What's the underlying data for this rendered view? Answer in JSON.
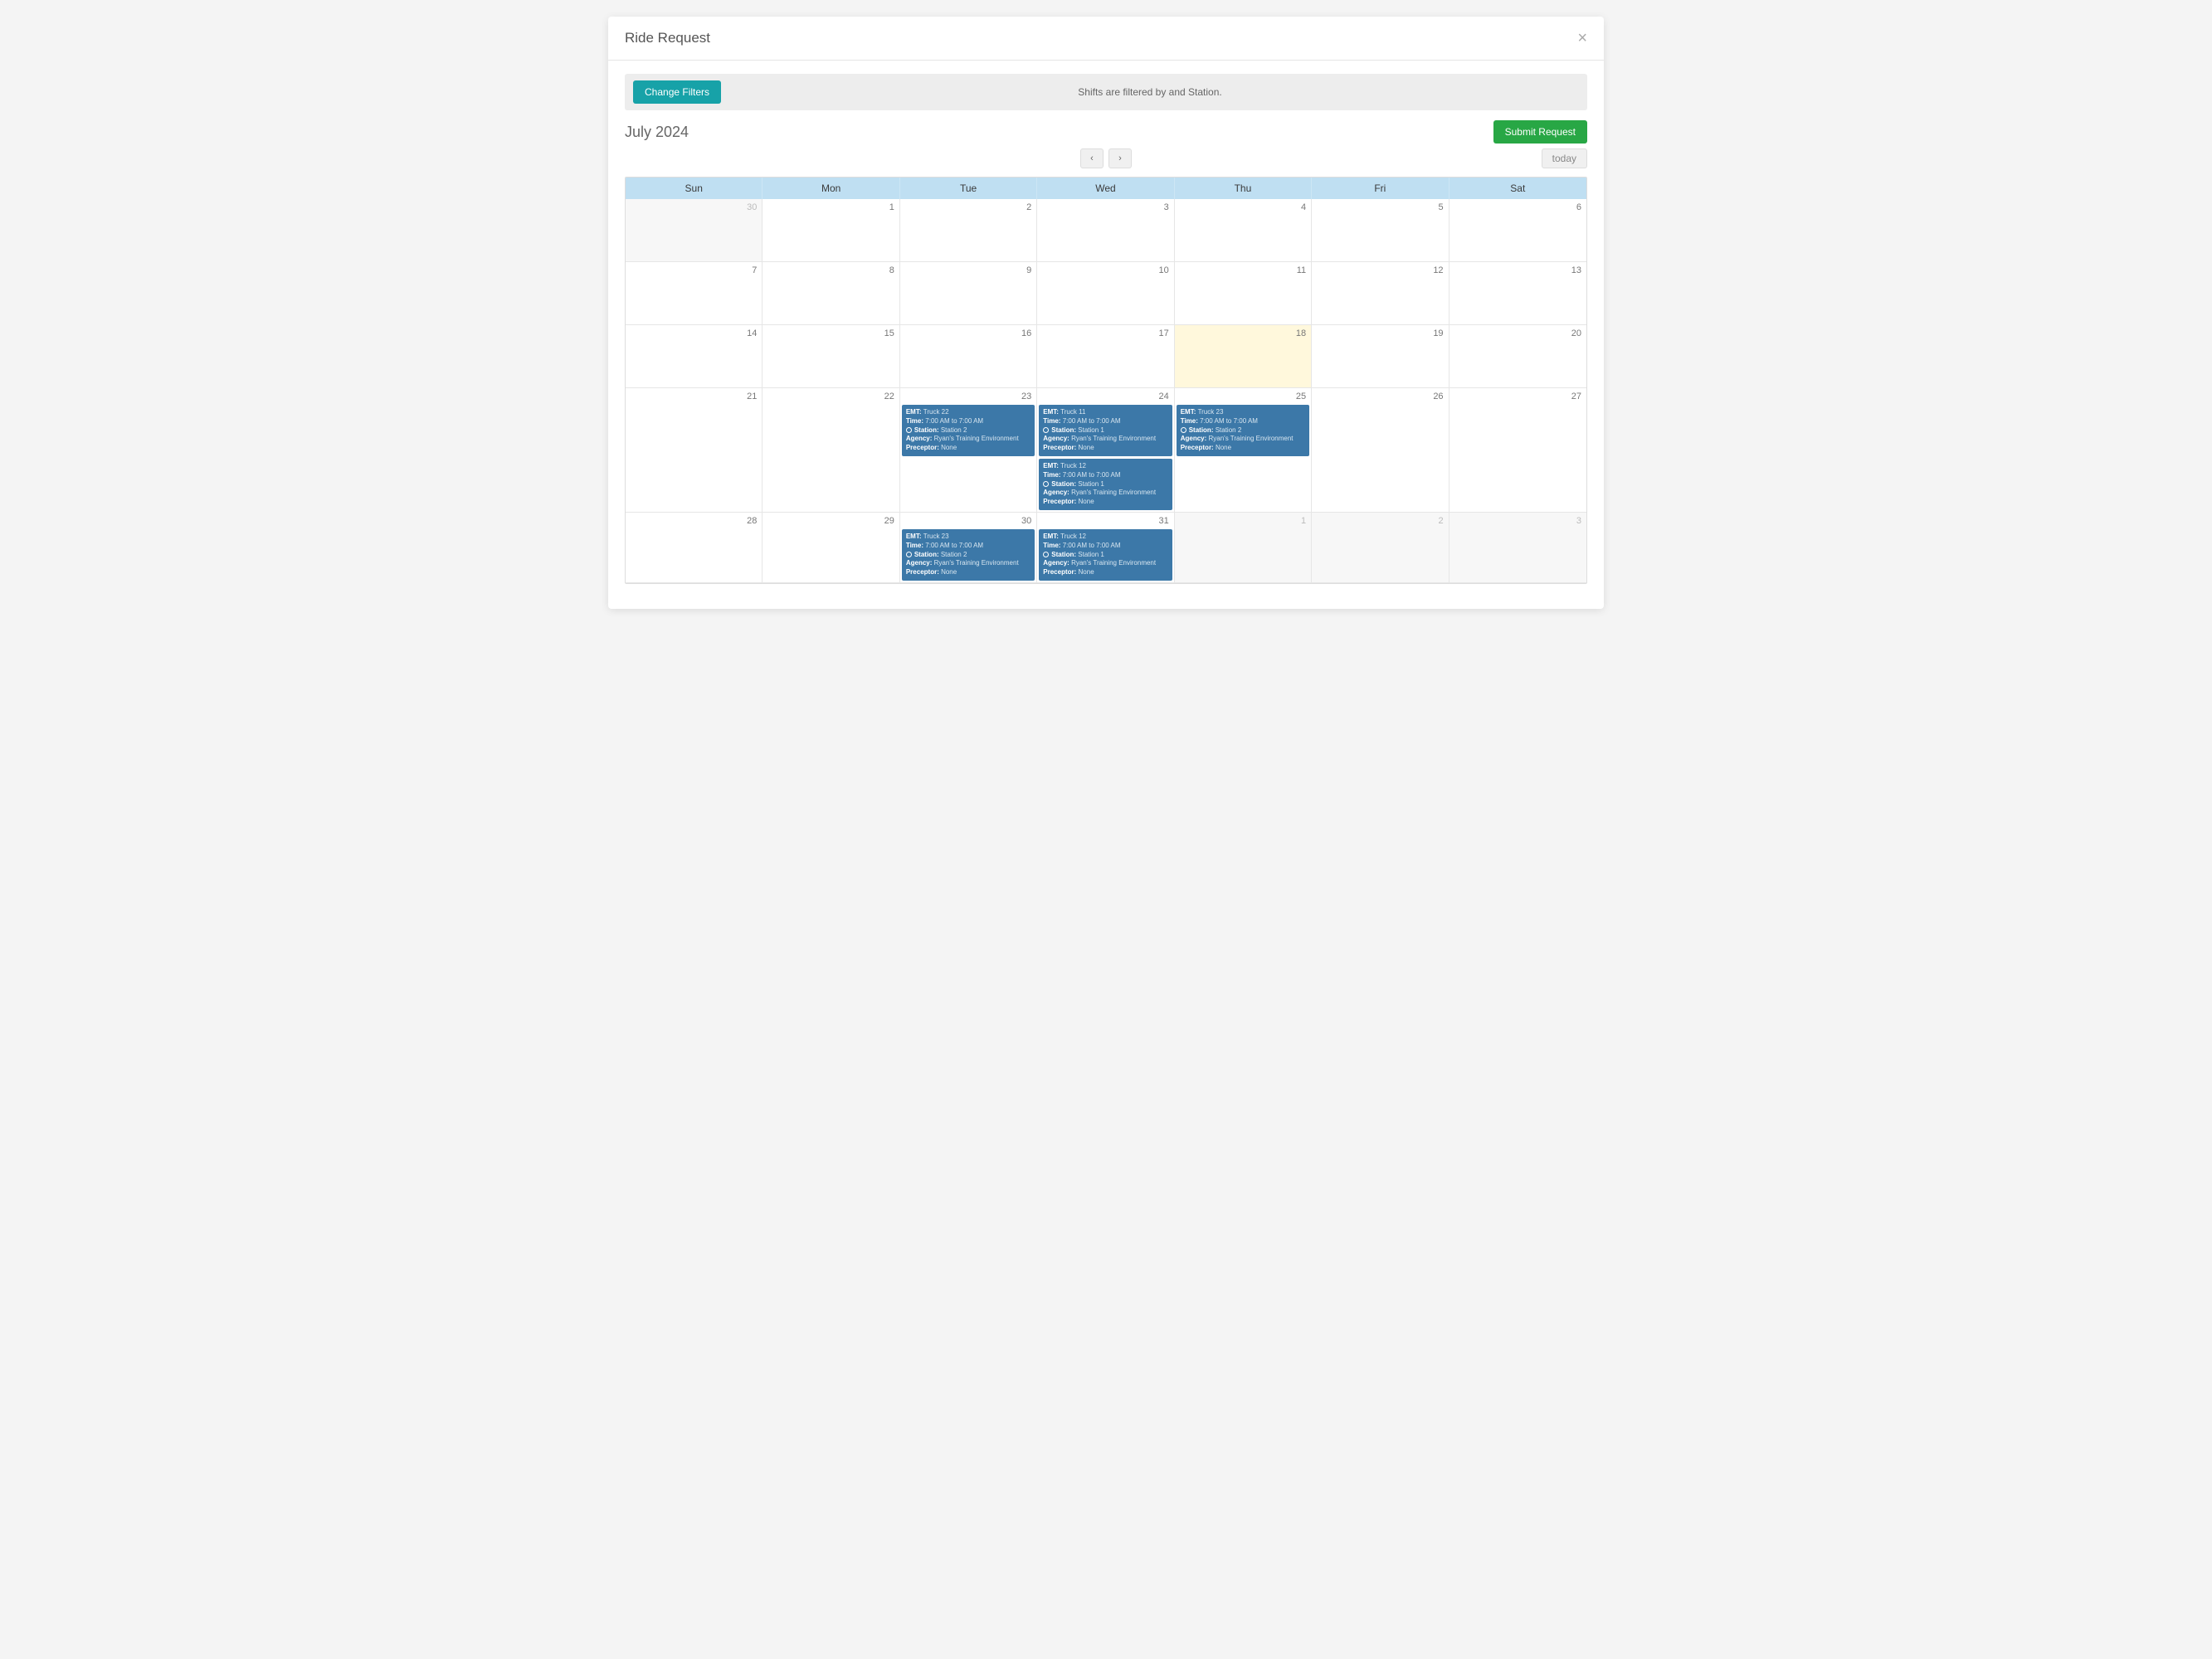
{
  "modal": {
    "title": "Ride Request",
    "close": "×"
  },
  "filterBar": {
    "changeFiltersLabel": "Change Filters",
    "statusText": "Shifts are filtered by and Station."
  },
  "toolbar": {
    "submitLabel": "Submit Request",
    "monthLabel": "July 2024",
    "prevIcon": "‹",
    "nextIcon": "›",
    "todayLabel": "today"
  },
  "calendar": {
    "dayHeaders": [
      "Sun",
      "Mon",
      "Tue",
      "Wed",
      "Thu",
      "Fri",
      "Sat"
    ],
    "cells": [
      {
        "date": "30",
        "otherMonth": true,
        "events": []
      },
      {
        "date": "1",
        "events": []
      },
      {
        "date": "2",
        "events": []
      },
      {
        "date": "3",
        "events": []
      },
      {
        "date": "4",
        "events": []
      },
      {
        "date": "5",
        "events": []
      },
      {
        "date": "6",
        "events": []
      },
      {
        "date": "7",
        "events": []
      },
      {
        "date": "8",
        "events": []
      },
      {
        "date": "9",
        "events": []
      },
      {
        "date": "10",
        "events": []
      },
      {
        "date": "11",
        "events": []
      },
      {
        "date": "12",
        "events": []
      },
      {
        "date": "13",
        "events": []
      },
      {
        "date": "14",
        "events": []
      },
      {
        "date": "15",
        "events": []
      },
      {
        "date": "16",
        "events": []
      },
      {
        "date": "17",
        "events": []
      },
      {
        "date": "18",
        "today": true,
        "events": []
      },
      {
        "date": "19",
        "events": []
      },
      {
        "date": "20",
        "events": []
      },
      {
        "date": "21",
        "events": []
      },
      {
        "date": "22",
        "events": []
      },
      {
        "date": "23",
        "events": [
          {
            "emt": "Truck 22",
            "time": "7:00 AM to 7:00 AM",
            "station": "Station 2",
            "agency": "Ryan's Training Environment",
            "preceptor": "None"
          }
        ]
      },
      {
        "date": "24",
        "events": [
          {
            "emt": "Truck 11",
            "time": "7:00 AM to 7:00 AM",
            "station": "Station 1",
            "agency": "Ryan's Training Environment",
            "preceptor": "None"
          },
          {
            "emt": "Truck 12",
            "time": "7:00 AM to 7:00 AM",
            "station": "Station 1",
            "agency": "Ryan's Training Environment",
            "preceptor": "None"
          }
        ]
      },
      {
        "date": "25",
        "events": [
          {
            "emt": "Truck 23",
            "time": "7:00 AM to 7:00 AM",
            "station": "Station 2",
            "agency": "Ryan's Training Environment",
            "preceptor": "None"
          }
        ]
      },
      {
        "date": "26",
        "events": []
      },
      {
        "date": "27",
        "events": []
      },
      {
        "date": "28",
        "events": []
      },
      {
        "date": "29",
        "events": []
      },
      {
        "date": "30",
        "events": [
          {
            "emt": "Truck 23",
            "time": "7:00 AM to 7:00 AM",
            "station": "Station 2",
            "agency": "Ryan's Training Environment",
            "preceptor": "None"
          }
        ]
      },
      {
        "date": "31",
        "events": [
          {
            "emt": "Truck 12",
            "time": "7:00 AM to 7:00 AM",
            "station": "Station 1",
            "agency": "Ryan's Training Environment",
            "preceptor": "None"
          }
        ]
      },
      {
        "date": "1",
        "otherMonth": true,
        "events": []
      },
      {
        "date": "2",
        "otherMonth": true,
        "events": []
      },
      {
        "date": "3",
        "otherMonth": true,
        "events": []
      }
    ],
    "eventLabels": {
      "emt": "EMT:",
      "time": "Time:",
      "station": "Station:",
      "agency": "Agency:",
      "preceptor": "Preceptor:"
    }
  }
}
